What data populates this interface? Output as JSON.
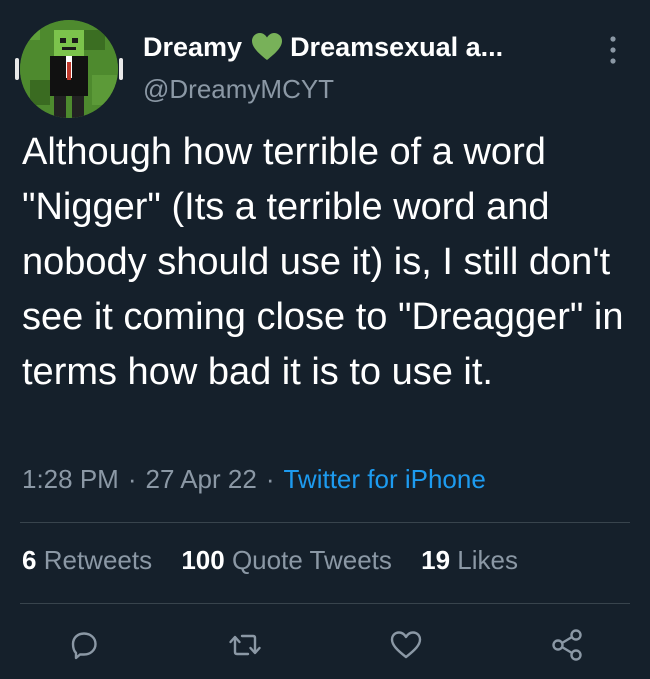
{
  "author": {
    "name_left": "Dreamy",
    "name_right": "Dreamsexual a...",
    "handle": "@DreamyMCYT"
  },
  "tweet": {
    "text": "Although how terrible of a word \"Nigger\" (Its a terrible word and nobody should use it) is, I still don't see it coming close to \"Dreagger\" in terms how bad it is to use it."
  },
  "meta": {
    "time": "1:28 PM",
    "separator": "·",
    "date": "27 Apr 22",
    "source": "Twitter for iPhone"
  },
  "stats": {
    "retweets_count": "6",
    "retweets_label": "Retweets",
    "quotes_count": "100",
    "quotes_label": "Quote Tweets",
    "likes_count": "19",
    "likes_label": "Likes"
  },
  "icons": {
    "heart_emoji": "green-heart-icon",
    "more": "more-vertical-icon",
    "reply": "reply-icon",
    "retweet": "retweet-icon",
    "like": "like-icon",
    "share": "share-icon"
  },
  "colors": {
    "background": "#15202b",
    "text": "#ffffff",
    "secondary": "#8b98a5",
    "link": "#1d9bf0",
    "divider": "#38444d",
    "green_heart": "#78b159"
  }
}
